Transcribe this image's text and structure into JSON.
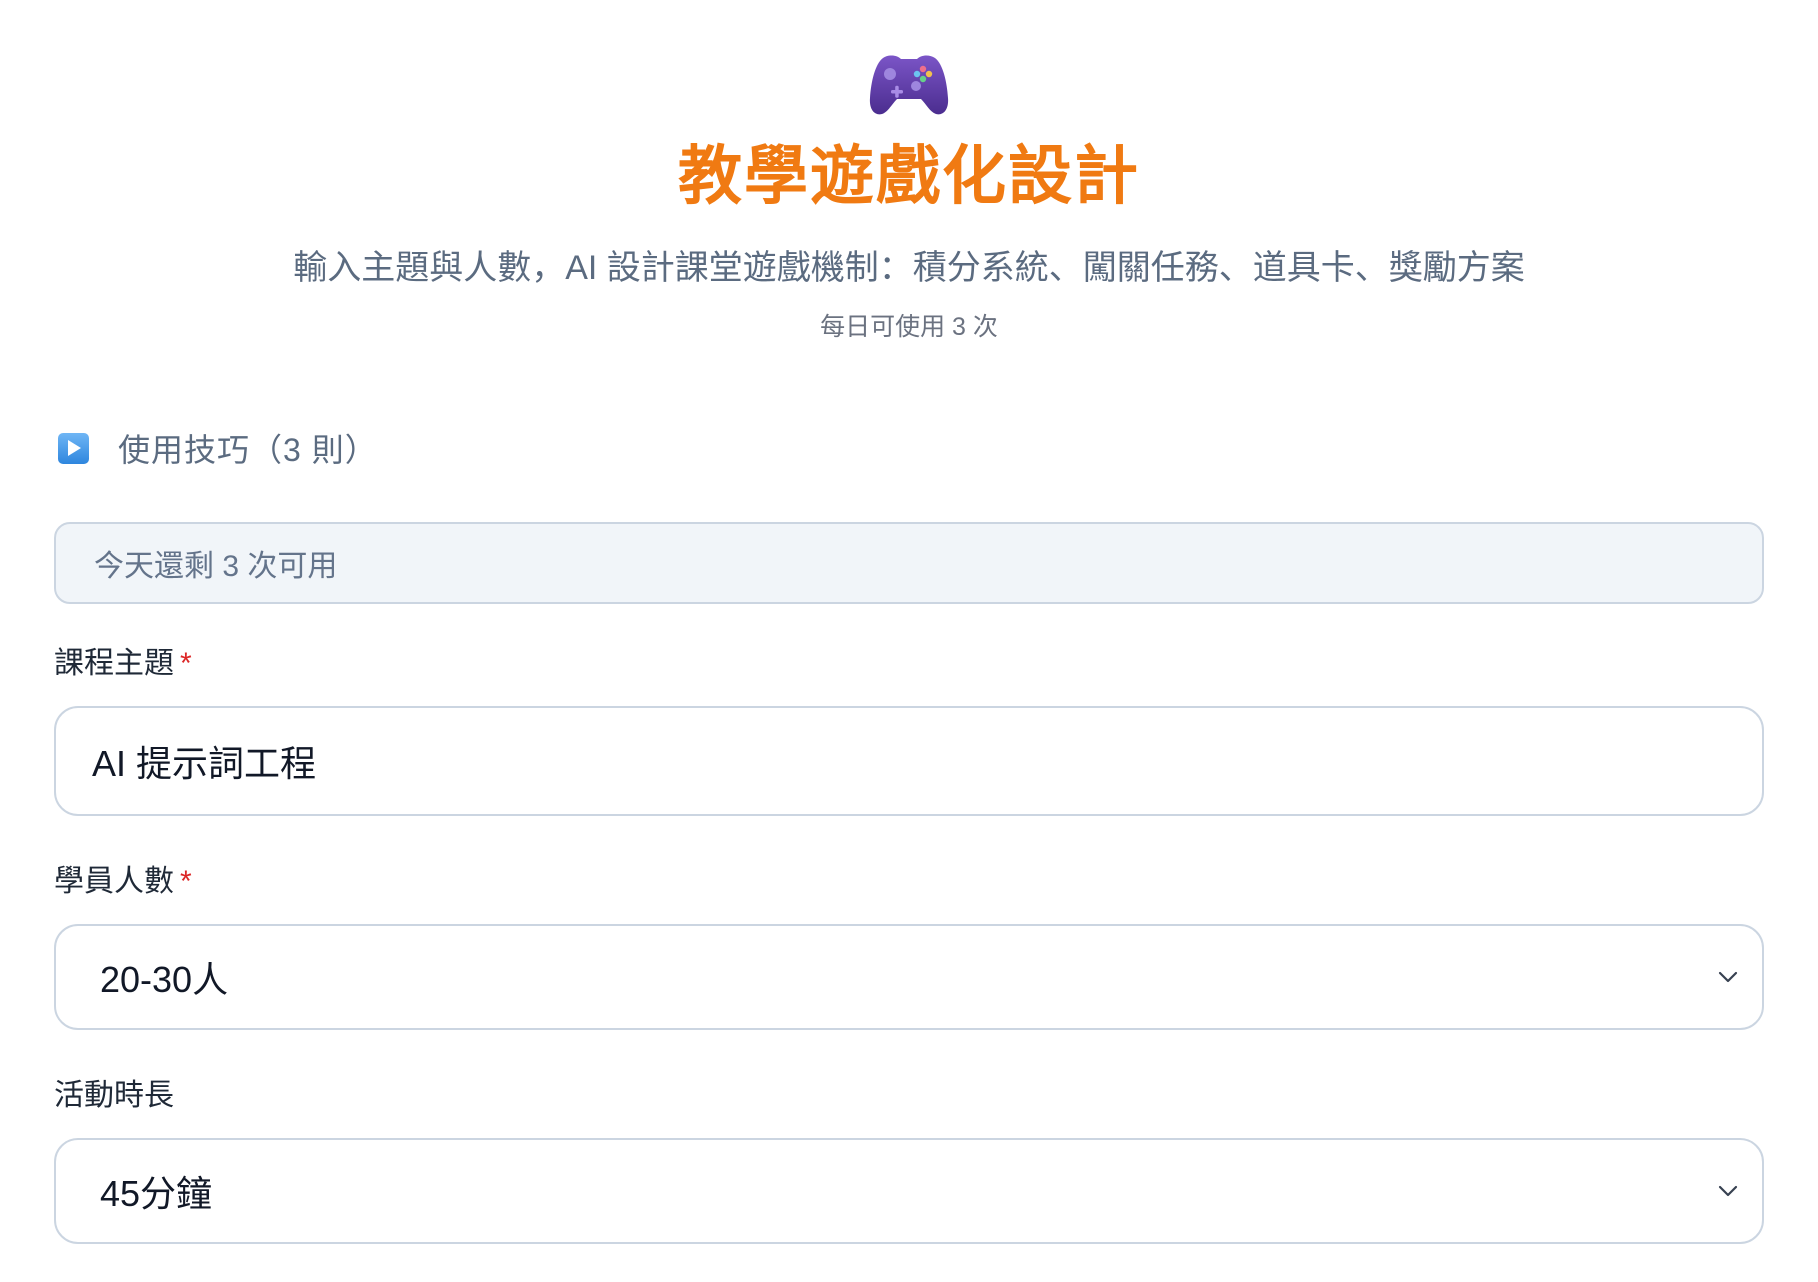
{
  "header": {
    "logo_icon": "gamepad-icon",
    "title": "教學遊戲化設計",
    "subtitle": "輸入主題與人數，AI 設計課堂遊戲機制：積分系統、闖關任務、道具卡、獎勵方案",
    "quota_note": "每日可使用 3 次"
  },
  "tips": {
    "icon": "play-icon",
    "label": "使用技巧（3 則）"
  },
  "remaining": {
    "text": "今天還剩 3 次可用"
  },
  "form": {
    "topic": {
      "label": "課程主題",
      "required_mark": "*",
      "value": "AI 提示詞工程"
    },
    "students": {
      "label": "學員人數",
      "required_mark": "*",
      "selected": "20-30人"
    },
    "duration": {
      "label": "活動時長",
      "selected": "45分鐘"
    }
  },
  "colors": {
    "title": "#f07a12",
    "required": "#dc2626",
    "border": "#cbd5e1",
    "notice_bg": "#f1f5f9",
    "gamepad": "#5b3a9e"
  }
}
